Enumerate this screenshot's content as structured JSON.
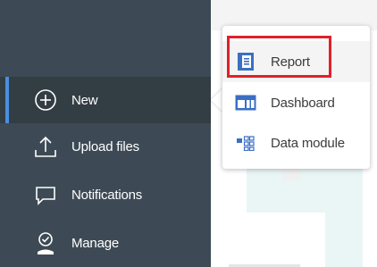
{
  "sidebar": {
    "items": [
      {
        "label": "New",
        "icon": "plus-circle-icon"
      },
      {
        "label": "Upload files",
        "icon": "upload-icon"
      },
      {
        "label": "Notifications",
        "icon": "chat-bubble-icon"
      },
      {
        "label": "Manage",
        "icon": "manage-user-icon"
      }
    ],
    "active_item": "New",
    "colors": {
      "background": "#3d4a55",
      "active": "#333d44",
      "accent": "#4a8fe0"
    }
  },
  "new_menu": {
    "items": [
      {
        "label": "Report",
        "icon": "report-icon"
      },
      {
        "label": "Dashboard",
        "icon": "dashboard-icon"
      },
      {
        "label": "Data module",
        "icon": "data-module-icon"
      }
    ],
    "selected": "Report",
    "highlight_color": "#e0202a"
  }
}
